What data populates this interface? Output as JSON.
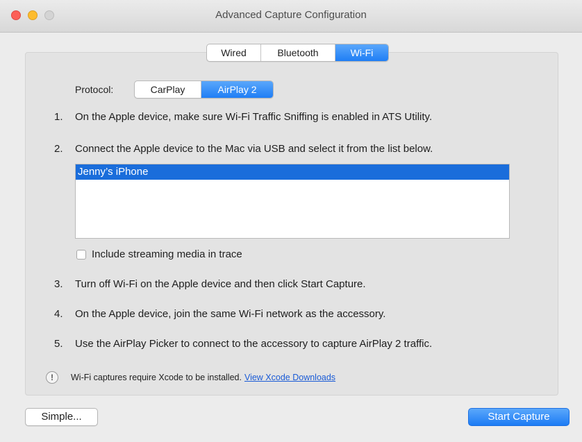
{
  "window": {
    "title": "Advanced Capture Configuration"
  },
  "connection_tabs": [
    {
      "label": "Wired",
      "selected": false
    },
    {
      "label": "Bluetooth",
      "selected": false
    },
    {
      "label": "Wi-Fi",
      "selected": true
    }
  ],
  "protocol": {
    "label": "Protocol:",
    "options": [
      {
        "label": "CarPlay",
        "selected": false
      },
      {
        "label": "AirPlay 2",
        "selected": true
      }
    ]
  },
  "steps": [
    {
      "num": "1.",
      "text": "On the Apple device, make sure Wi-Fi Traffic Sniffing is enabled in ATS Utility."
    },
    {
      "num": "2.",
      "text": "Connect the Apple device to the Mac via USB and select it from the list below."
    },
    {
      "num": "3.",
      "text": "Turn off Wi-Fi on the Apple device and then click Start Capture."
    },
    {
      "num": "4.",
      "text": "On the Apple device, join the same Wi-Fi network as the accessory."
    },
    {
      "num": "5.",
      "text": "Use the AirPlay Picker to connect to the accessory to capture AirPlay 2 traffic."
    }
  ],
  "device_list": {
    "items": [
      {
        "name": "Jenny’s iPhone",
        "selected": true
      }
    ]
  },
  "streaming_checkbox": {
    "label": "Include streaming media in trace",
    "checked": false
  },
  "notice": {
    "icon": "exclamation-icon",
    "icon_glyph": "!",
    "text": "Wi-Fi captures require Xcode to be installed.",
    "link_text": "View Xcode Downloads"
  },
  "buttons": {
    "simple": "Simple...",
    "start_capture": "Start Capture"
  },
  "colors": {
    "accent": "#1f7ef5",
    "selection": "#1a6ddb",
    "link": "#1a5bd6"
  }
}
